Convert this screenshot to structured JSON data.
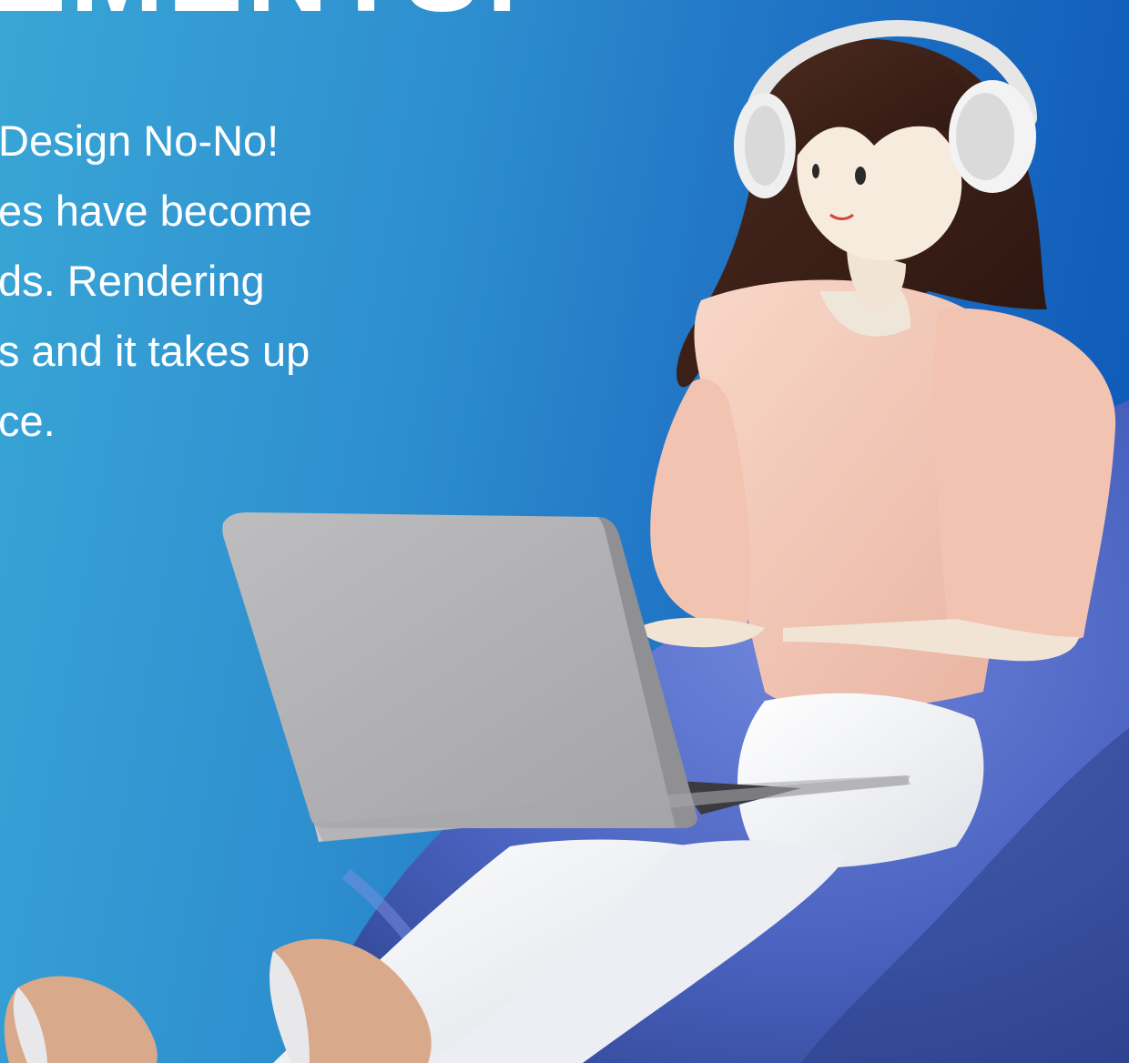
{
  "slide": {
    "headline": "EMENTS:",
    "body_lines": [
      "Design No-No!",
      "es have become",
      "ds. Rendering",
      "s and it takes up",
      "ce."
    ]
  },
  "illustration": {
    "subject": "3d-girl-with-headphones-using-laptop-on-beanbag",
    "colors": {
      "background_left": "#39a6d6",
      "background_right": "#0b55b6",
      "beanbag": "#4a66c4",
      "sweater": "#f4c9b8",
      "hair": "#3a2018",
      "laptop": "#b8b8bc",
      "pants": "#eef0f4",
      "shoes": "#d9a98c"
    }
  }
}
